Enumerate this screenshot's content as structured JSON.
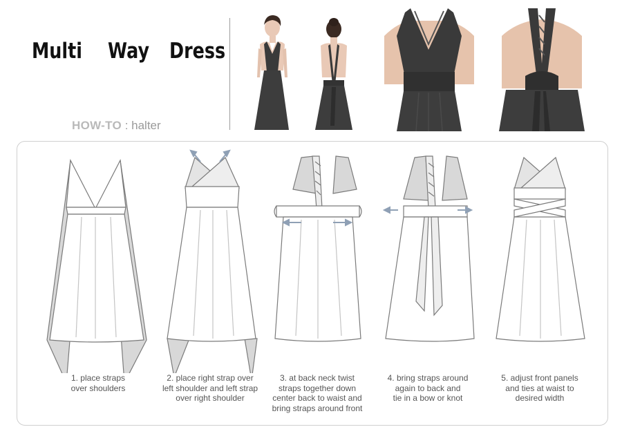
{
  "header": {
    "title_words": [
      "Multi",
      "Way",
      "Dress"
    ],
    "howto_label": "HOW-TO",
    "howto_sep": " : ",
    "howto_style": "halter"
  },
  "photos": [
    {
      "name": "model-front-photo"
    },
    {
      "name": "model-back-photo"
    },
    {
      "name": "closeup-front-photo"
    },
    {
      "name": "closeup-back-photo"
    }
  ],
  "steps": [
    {
      "caption": "1. place straps\nover shoulders"
    },
    {
      "caption": "2. place right strap over\nleft shoulder and left strap\nover right shoulder"
    },
    {
      "caption": "3. at back neck twist\nstraps together down\ncenter back to waist and\nbring straps around front"
    },
    {
      "caption": "4. bring straps around\nagain to back and\ntie in a bow or knot"
    },
    {
      "caption": "5. adjust front panels\nand ties at waist to\ndesired width"
    }
  ],
  "colors": {
    "dress_dark": "#3a3a3a",
    "sketch_line": "#7a7a7a",
    "sketch_fill": "#d8d8d8",
    "arrow": "#8fa0b5"
  }
}
